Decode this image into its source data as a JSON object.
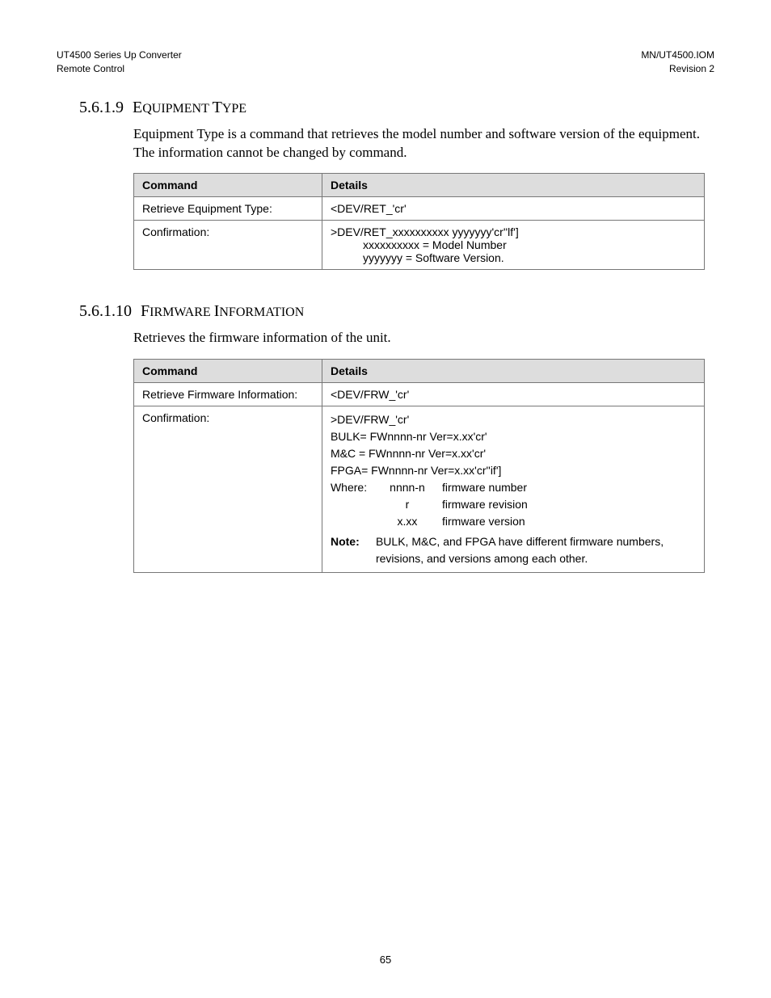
{
  "header": {
    "left_line1": "UT4500 Series Up Converter",
    "left_line2": "Remote Control",
    "right_line1": "MN/UT4500.IOM",
    "right_line2": "Revision 2"
  },
  "section1": {
    "number": "5.6.1.9",
    "title_main": "E",
    "title_rest_1": "QUIPMENT ",
    "title_main2": "T",
    "title_rest_2": "YPE",
    "body": "Equipment Type is a command that retrieves the model number and software version of the equipment.  The information cannot be changed by command.",
    "col_command": "Command",
    "col_details": "Details",
    "row1_cmd": "Retrieve Equipment Type:",
    "row1_det": "<DEV/RET_'cr'",
    "row2_cmd": "Confirmation:",
    "row2_det_l1": ">DEV/RET_xxxxxxxxxx yyyyyyy'cr''lf']",
    "row2_det_l2": "xxxxxxxxxx = Model Number",
    "row2_det_l3": "yyyyyyy = Software Version."
  },
  "section2": {
    "number": "5.6.1.10",
    "title_main": "F",
    "title_rest_1": "IRMWARE ",
    "title_main2": "I",
    "title_rest_2": "NFORMATION",
    "body": "Retrieves the firmware information of the unit.",
    "col_command": "Command",
    "col_details": "Details",
    "row1_cmd": "Retrieve Firmware Information:",
    "row1_det": "<DEV/FRW_'cr'",
    "row2_cmd": "Confirmation:",
    "conf_l1": ">DEV/FRW_'cr'",
    "conf_l2": "BULK= FWnnnn-nr  Ver=x.xx'cr'",
    "conf_l3": "M&C = FWnnnn-nr  Ver=x.xx'cr'",
    "conf_l4": "FPGA= FWnnnn-nr  Ver=x.xx'cr''if']",
    "where_label": "Where:",
    "where_k1": "nnnn-n",
    "where_v1": "firmware number",
    "where_k2": "r",
    "where_v2": "firmware revision",
    "where_k3": "x.xx",
    "where_v3": "firmware version",
    "note_label": "Note:",
    "note_text": "BULK, M&C, and FPGA have different firmware numbers, revisions, and versions among each other."
  },
  "page_number": "65"
}
